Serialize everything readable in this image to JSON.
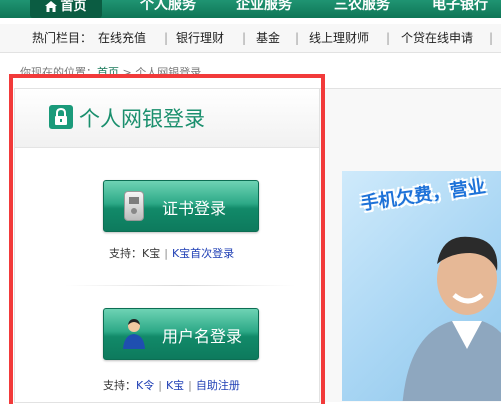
{
  "nav": {
    "items": [
      "首页",
      "个人服务",
      "企业服务",
      "三农服务",
      "电子银行"
    ]
  },
  "hotbar": {
    "label": "热门栏目：",
    "links": [
      "在线充值",
      "银行理财",
      "基金",
      "线上理财师",
      "个贷在线申请"
    ],
    "separator": "|"
  },
  "breadcrumb": {
    "prefix": "你现在的位置：",
    "home": "首页",
    "arrow": ">",
    "current": "个人网银登录"
  },
  "panel": {
    "title": "个人网银登录",
    "cert_login": {
      "label": "证书登录",
      "support_label": "支持：",
      "support_plain": "K宝",
      "support_link": "K宝首次登录"
    },
    "user_login": {
      "label": "用户名登录",
      "support_label": "支持：",
      "links": [
        "K令",
        "K宝",
        "自助注册"
      ]
    }
  },
  "ad": {
    "headline": "手机欠费，营业"
  },
  "colors": {
    "brand_green": "#1a8f6d",
    "highlight_red": "#f23a3a",
    "link_blue": "#1f3fb5"
  }
}
